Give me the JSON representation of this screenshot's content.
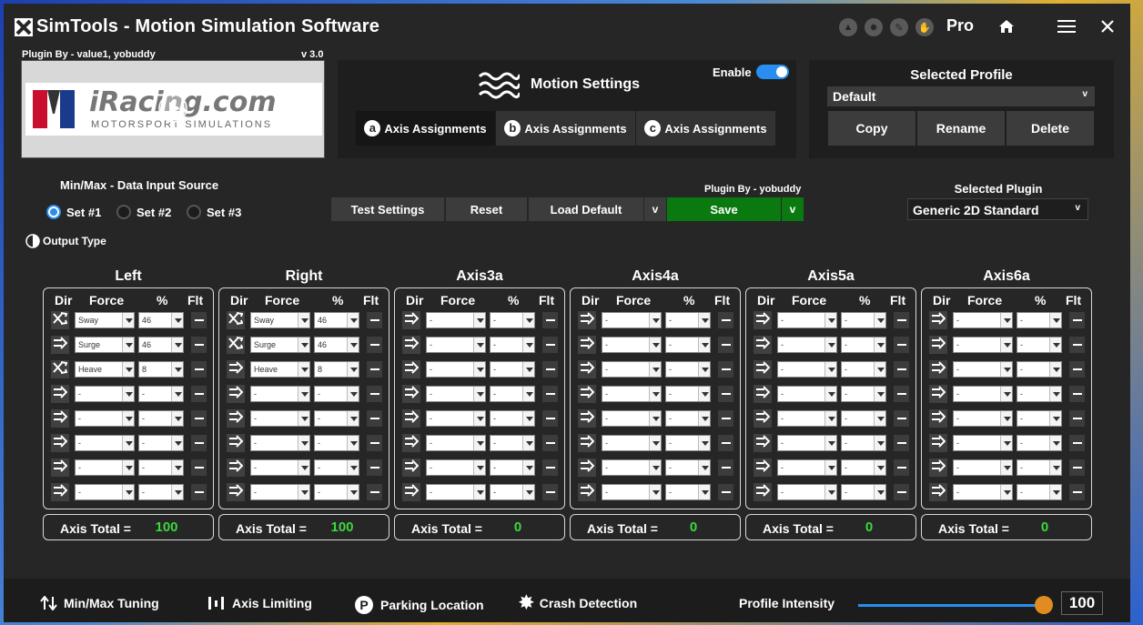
{
  "window": {
    "title": "SimTools - Motion Simulation Software",
    "edition": "Pro",
    "colors": {
      "background": "#262626",
      "accent": "#2a8ef0",
      "save": "#0a7a10",
      "total": "#3cd83c",
      "slider_knob": "#e08c20"
    }
  },
  "plugin_preview": {
    "credit": "Plugin By - value1, yobuddy",
    "version": "v 3.0",
    "logo_text": "iRacing.com",
    "logo_sub": "MOTORSPORT SIMULATIONS"
  },
  "motion_settings": {
    "title": "Motion Settings",
    "enable_label": "Enable",
    "enabled": true,
    "tabs": [
      {
        "badge": "a",
        "label": "Axis Assignments"
      },
      {
        "badge": "b",
        "label": "Axis Assignments"
      },
      {
        "badge": "c",
        "label": "Axis Assignments"
      }
    ]
  },
  "profile": {
    "title": "Selected Profile",
    "selected": "Default",
    "copy": "Copy",
    "rename": "Rename",
    "delete": "Delete"
  },
  "minmax": {
    "title": "Min/Max - Data Input Source",
    "sets": [
      "Set #1",
      "Set #2",
      "Set #3"
    ],
    "selected_index": 0
  },
  "output_type": "Output Type",
  "actions": {
    "plugin_credit": "Plugin By - yobuddy",
    "test": "Test Settings",
    "reset": "Reset",
    "load_default": "Load Default",
    "dropdown": "v",
    "save": "Save"
  },
  "plugin": {
    "title": "Selected Plugin",
    "selected": "Generic 2D Standard"
  },
  "column_headers": {
    "dir": "Dir",
    "force": "Force",
    "pct": "%",
    "flt": "Flt"
  },
  "total_label": "Axis Total =",
  "axes": [
    {
      "name": "Left",
      "total": "100",
      "rows": [
        {
          "dir": "cross",
          "force": "Sway",
          "pct": "46"
        },
        {
          "dir": "arrow",
          "force": "Surge",
          "pct": "46"
        },
        {
          "dir": "cross",
          "force": "Heave",
          "pct": "8"
        },
        {
          "dir": "arrow",
          "force": "-",
          "pct": "-"
        },
        {
          "dir": "arrow",
          "force": "-",
          "pct": "-"
        },
        {
          "dir": "arrow",
          "force": "-",
          "pct": "-"
        },
        {
          "dir": "arrow",
          "force": "-",
          "pct": "-"
        },
        {
          "dir": "arrow",
          "force": "-",
          "pct": "-"
        }
      ]
    },
    {
      "name": "Right",
      "total": "100",
      "rows": [
        {
          "dir": "cross",
          "force": "Sway",
          "pct": "46"
        },
        {
          "dir": "cross",
          "force": "Surge",
          "pct": "46"
        },
        {
          "dir": "arrow",
          "force": "Heave",
          "pct": "8"
        },
        {
          "dir": "arrow",
          "force": "-",
          "pct": "-"
        },
        {
          "dir": "arrow",
          "force": "-",
          "pct": "-"
        },
        {
          "dir": "arrow",
          "force": "-",
          "pct": "-"
        },
        {
          "dir": "arrow",
          "force": "-",
          "pct": "-"
        },
        {
          "dir": "arrow",
          "force": "-",
          "pct": "-"
        }
      ]
    },
    {
      "name": "Axis3a",
      "total": "0",
      "rows": [
        {
          "dir": "arrow",
          "force": "-",
          "pct": "-"
        },
        {
          "dir": "arrow",
          "force": "-",
          "pct": "-"
        },
        {
          "dir": "arrow",
          "force": "-",
          "pct": "-"
        },
        {
          "dir": "arrow",
          "force": "-",
          "pct": "-"
        },
        {
          "dir": "arrow",
          "force": "-",
          "pct": "-"
        },
        {
          "dir": "arrow",
          "force": "-",
          "pct": "-"
        },
        {
          "dir": "arrow",
          "force": "-",
          "pct": "-"
        },
        {
          "dir": "arrow",
          "force": "-",
          "pct": "-"
        }
      ]
    },
    {
      "name": "Axis4a",
      "total": "0",
      "rows": [
        {
          "dir": "arrow",
          "force": "-",
          "pct": "-"
        },
        {
          "dir": "arrow",
          "force": "-",
          "pct": "-"
        },
        {
          "dir": "arrow",
          "force": "-",
          "pct": "-"
        },
        {
          "dir": "arrow",
          "force": "-",
          "pct": "-"
        },
        {
          "dir": "arrow",
          "force": "-",
          "pct": "-"
        },
        {
          "dir": "arrow",
          "force": "-",
          "pct": "-"
        },
        {
          "dir": "arrow",
          "force": "-",
          "pct": "-"
        },
        {
          "dir": "arrow",
          "force": "-",
          "pct": "-"
        }
      ]
    },
    {
      "name": "Axis5a",
      "total": "0",
      "rows": [
        {
          "dir": "arrow",
          "force": "-",
          "pct": "-"
        },
        {
          "dir": "arrow",
          "force": "-",
          "pct": "-"
        },
        {
          "dir": "arrow",
          "force": "-",
          "pct": "-"
        },
        {
          "dir": "arrow",
          "force": "-",
          "pct": "-"
        },
        {
          "dir": "arrow",
          "force": "-",
          "pct": "-"
        },
        {
          "dir": "arrow",
          "force": "-",
          "pct": "-"
        },
        {
          "dir": "arrow",
          "force": "-",
          "pct": "-"
        },
        {
          "dir": "arrow",
          "force": "-",
          "pct": "-"
        }
      ]
    },
    {
      "name": "Axis6a",
      "total": "0",
      "rows": [
        {
          "dir": "arrow",
          "force": "-",
          "pct": "-"
        },
        {
          "dir": "arrow",
          "force": "-",
          "pct": "-"
        },
        {
          "dir": "arrow",
          "force": "-",
          "pct": "-"
        },
        {
          "dir": "arrow",
          "force": "-",
          "pct": "-"
        },
        {
          "dir": "arrow",
          "force": "-",
          "pct": "-"
        },
        {
          "dir": "arrow",
          "force": "-",
          "pct": "-"
        },
        {
          "dir": "arrow",
          "force": "-",
          "pct": "-"
        },
        {
          "dir": "arrow",
          "force": "-",
          "pct": "-"
        }
      ]
    }
  ],
  "bottom": {
    "minmax_tuning": "Min/Max Tuning",
    "axis_limiting": "Axis Limiting",
    "parking_location": "Parking Location",
    "crash_detection": "Crash Detection",
    "intensity_label": "Profile Intensity",
    "intensity_value": "100",
    "intensity_fraction": 1.0
  }
}
